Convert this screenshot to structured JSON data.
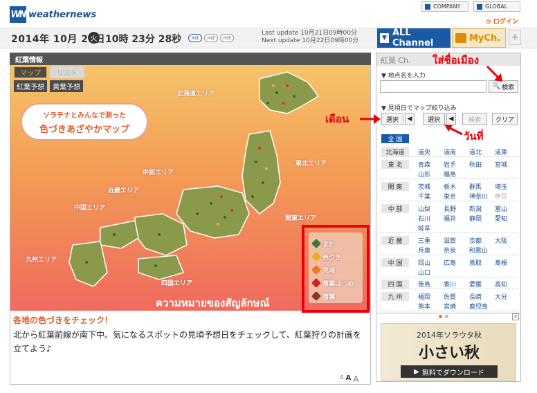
{
  "header": {
    "logo_mark": "WN",
    "logo_text": "weathernews",
    "company_label": "COMPANY",
    "global_label": "GLOBAL",
    "login_label": "ログイン"
  },
  "datebar": {
    "date": "2014年 10月 21日",
    "day_of_week": "火",
    "time": "10時 23分 28秒",
    "modes": [
      "m1",
      "m2",
      "m3"
    ],
    "last_update": "Last update  10月21日09時00分",
    "next_update": "Next update  10月22日09時00分",
    "all_channel": "ALL Channel",
    "mych": "MyCh.",
    "plus": "+"
  },
  "main": {
    "title": "紅葉情報",
    "tabs": [
      "マップ",
      "リスト"
    ],
    "subtabs": [
      "紅葉予想",
      "黄葉予想"
    ],
    "bubble_line1": "ソラテナとみんなで測った",
    "bubble_line2": "色づきあざやかマップ",
    "areas": [
      "北海道エリア",
      "東北エリア",
      "中部エリア",
      "近畿エリア",
      "中国エリア",
      "関東エリア",
      "九州エリア",
      "四国エリア"
    ],
    "legend": [
      {
        "label": "まだ",
        "color": "#3f7a3a"
      },
      {
        "label": "色づき",
        "color": "#e9b024"
      },
      {
        "label": "見頃",
        "color": "#ef7a1a"
      },
      {
        "label": "落葉はじめ",
        "color": "#c8281a"
      },
      {
        "label": "落葉",
        "color": "#8a3a1a"
      }
    ],
    "caption": "ความหมายของสัญลักษณ์",
    "desc_title": "各地の色づきをチェック！",
    "desc_text": "北から紅葉前線が南下中。気になるスポットの見頃予想日をチェックして、紅葉狩りの計画を立てよう♪",
    "font_sizes": [
      "A",
      "A",
      "A"
    ]
  },
  "side": {
    "title": "紅葉 Ch.",
    "search_heading": "▼ 地点名を入力",
    "search_button": "検索",
    "filter_heading": "▼ 見頃日でマップ絞り込み",
    "select1": "選択",
    "select2": "選択",
    "arrow": "◀",
    "filter_search": "検索",
    "clear": "クリア",
    "all_country": "全 国",
    "regions": [
      {
        "name": "北海道",
        "cities": [
          [
            "道央",
            "道南",
            "道北",
            "道東"
          ]
        ]
      },
      {
        "name": "東 北",
        "cities": [
          [
            "青森",
            "岩手",
            "秋田",
            "宮城"
          ],
          [
            "山形",
            "福島"
          ]
        ]
      },
      {
        "name": "関 東",
        "cities": [
          [
            "茨城",
            "栃木",
            "群馬",
            "埼玉"
          ],
          [
            "千葉",
            "東京",
            "神奈川",
            "伊豆"
          ]
        ]
      },
      {
        "name": "中 部",
        "cities": [
          [
            "山梨",
            "長野",
            "新潟",
            "富山"
          ],
          [
            "石川",
            "福井",
            "静岡",
            "愛知"
          ],
          [
            "岐阜"
          ]
        ]
      },
      {
        "name": "近 畿",
        "cities": [
          [
            "三重",
            "滋賀",
            "京都",
            "大阪"
          ],
          [
            "兵庫",
            "奈良",
            "和歌山"
          ]
        ]
      },
      {
        "name": "中 国",
        "cities": [
          [
            "岡山",
            "広島",
            "鳥取",
            "島根"
          ],
          [
            "山口"
          ]
        ]
      },
      {
        "name": "四 国",
        "cities": [
          [
            "徳島",
            "香川",
            "愛媛",
            "高知"
          ]
        ]
      },
      {
        "name": "九 州",
        "cities": [
          [
            "福岡",
            "佐賀",
            "長崎",
            "大分"
          ],
          [
            "熊本",
            "宮崎",
            "鹿児島"
          ]
        ]
      }
    ],
    "ad_line1": "2014年ソラウタ秋",
    "ad_line2": "小さい秋",
    "ad_button": "無料でダウンロード"
  },
  "annotations": {
    "city": "ใส่ชื่อเมือง",
    "month": "เดือน",
    "day": "วันที่"
  }
}
